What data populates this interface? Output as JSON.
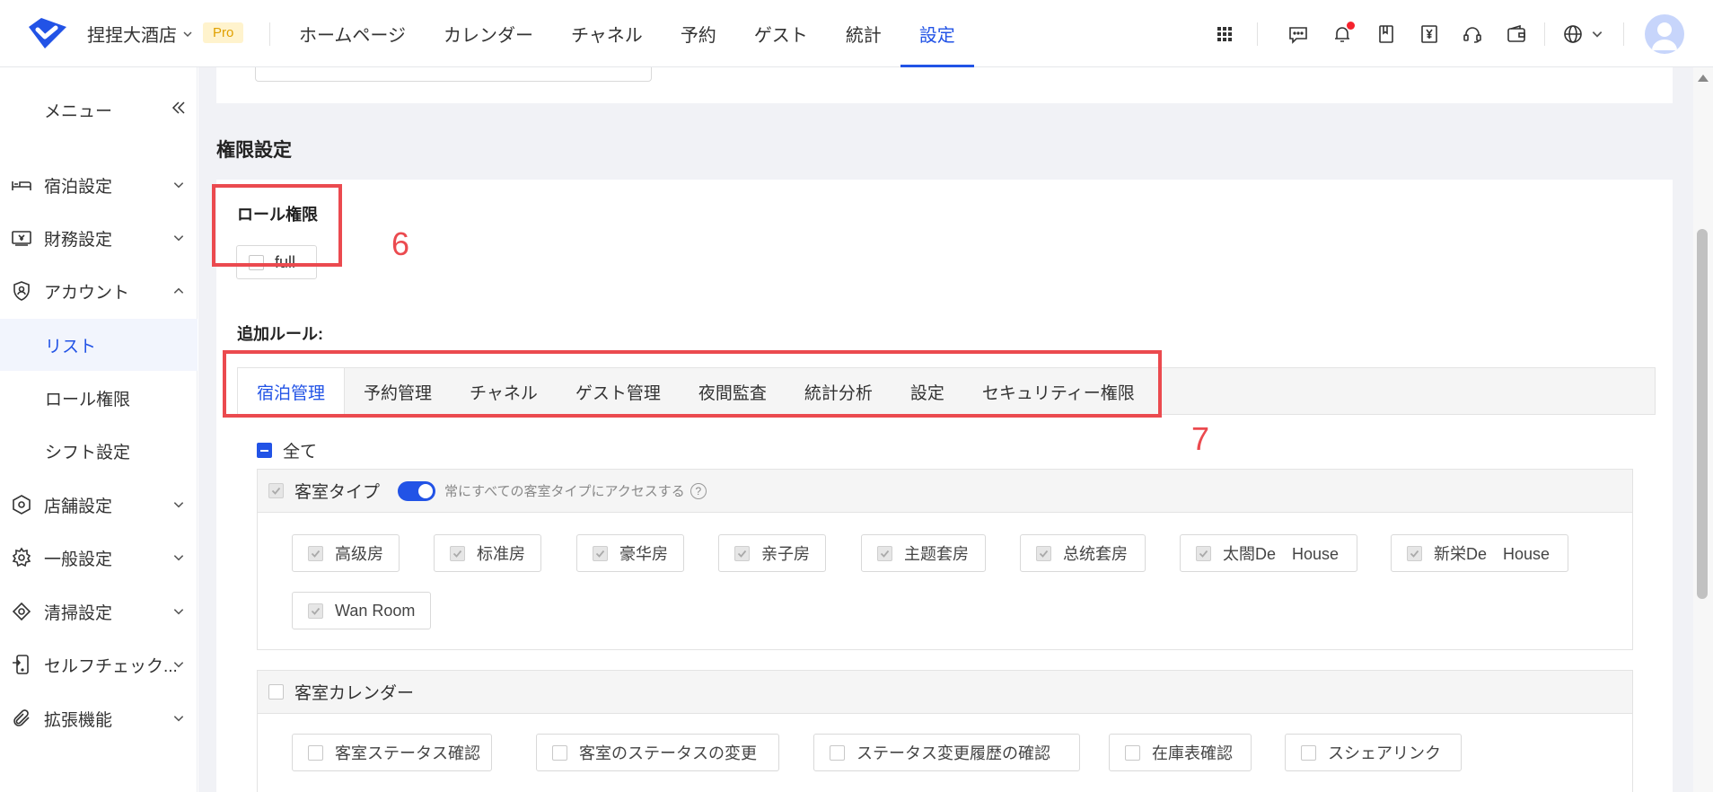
{
  "header": {
    "hotel_name": "捏捏大酒店",
    "pro_badge": "Pro",
    "nav": [
      "ホームページ",
      "カレンダー",
      "チャネル",
      "予約",
      "ゲスト",
      "統計",
      "設定"
    ],
    "active_nav": "設定"
  },
  "sidebar": {
    "title": "メニュー",
    "items": [
      {
        "label": "宿泊設定",
        "icon": "bed-icon"
      },
      {
        "label": "財務設定",
        "icon": "finance-icon"
      },
      {
        "label": "アカウント",
        "icon": "account-shield-icon"
      },
      {
        "label": "リスト"
      },
      {
        "label": "ロール権限"
      },
      {
        "label": "シフト設定"
      },
      {
        "label": "店舗設定",
        "icon": "store-icon"
      },
      {
        "label": "一般設定",
        "icon": "gear-icon"
      },
      {
        "label": "清掃設定",
        "icon": "cleaning-icon"
      },
      {
        "label": "セルフチェック...",
        "icon": "self-checkin-icon"
      },
      {
        "label": "拡張機能",
        "icon": "paperclip-icon"
      }
    ]
  },
  "main": {
    "section_title": "権限設定",
    "role_title": "ロール権限",
    "role_option": "full",
    "annotation_role": "6",
    "additional_rules_title": "追加ルール:",
    "tabs": [
      "宿泊管理",
      "予約管理",
      "チャネル",
      "ゲスト管理",
      "夜間監査",
      "統計分析",
      "設定",
      "セキュリティー権限"
    ],
    "active_tab": "宿泊管理",
    "annotation_tabs": "7",
    "select_all": "全て",
    "room_type_group": {
      "label": "客室タイプ",
      "toggle_label": "常にすべての客室タイプにアクセスする",
      "help": "?",
      "options": [
        "高级房",
        "标准房",
        "豪华房",
        "亲子房",
        "主题套房",
        "总统套房",
        "太閤De　House",
        "新栄De　House",
        "Wan Room"
      ]
    },
    "calendar_group": {
      "label": "客室カレンダー",
      "options": [
        "客室ステータス確認",
        "客室のステータスの変更",
        "ステータス変更履歴の確認",
        "在庫表確認",
        "スシェアリンク"
      ]
    }
  },
  "colors": {
    "accent": "#2253e6",
    "annotation": "#eb4a4f",
    "pro_bg": "#fff3cd"
  }
}
